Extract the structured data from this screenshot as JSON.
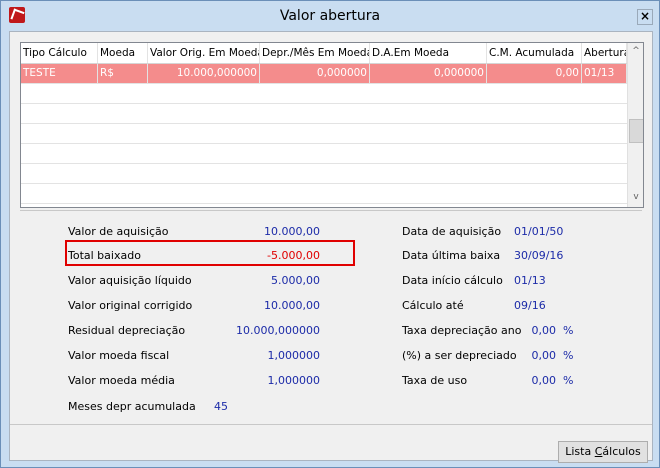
{
  "window": {
    "title": "Valor abertura",
    "close_glyph": "×"
  },
  "grid": {
    "columns": [
      "Tipo Cálculo",
      "Moeda",
      "Valor Orig. Em Moeda",
      "Depr./Mês Em Moeda",
      "D.A.Em Moeda",
      "C.M. Acumulada",
      "Abertura"
    ],
    "rows": [
      [
        "TESTE",
        "R$",
        "10.000,000000",
        "0,000000",
        "0,000000",
        "0,00",
        "01/13"
      ]
    ],
    "scroll_up": "^",
    "scroll_down": "v"
  },
  "left_fields": [
    {
      "label": "Valor de aquisição",
      "value": "10.000,00"
    },
    {
      "label": "Total baixado",
      "value": "-5.000,00"
    },
    {
      "label": "Valor aquisição líquido",
      "value": "5.000,00"
    },
    {
      "label": "Valor original corrigido",
      "value": "10.000,00"
    },
    {
      "label": "Residual depreciação",
      "value": "10.000,000000"
    },
    {
      "label": "Valor moeda fiscal",
      "value": "1,000000"
    },
    {
      "label": "Valor moeda média",
      "value": "1,000000"
    },
    {
      "label": "Meses depr acumulada",
      "value": "45"
    }
  ],
  "right_fields": [
    {
      "label": "Data de aquisição",
      "value": "01/01/50"
    },
    {
      "label": "Data última baixa",
      "value": "30/09/16"
    },
    {
      "label": "Data início cálculo",
      "value": "01/13"
    },
    {
      "label": "Cálculo até",
      "value": "09/16"
    },
    {
      "label": "Taxa depreciação ano",
      "value": "0,00",
      "unit": "%"
    },
    {
      "label": "(%) a ser depreciado",
      "value": "0,00",
      "unit": "%"
    },
    {
      "label": "Taxa de uso",
      "value": "0,00",
      "unit": "%"
    }
  ],
  "buttons": {
    "lista_prefix": "Lista ",
    "lista_underlined": "C",
    "lista_suffix": "álculos"
  },
  "colors": {
    "selected_row": "#f48c8c",
    "value_text": "#1c2ba8",
    "highlight": "#e00000"
  }
}
